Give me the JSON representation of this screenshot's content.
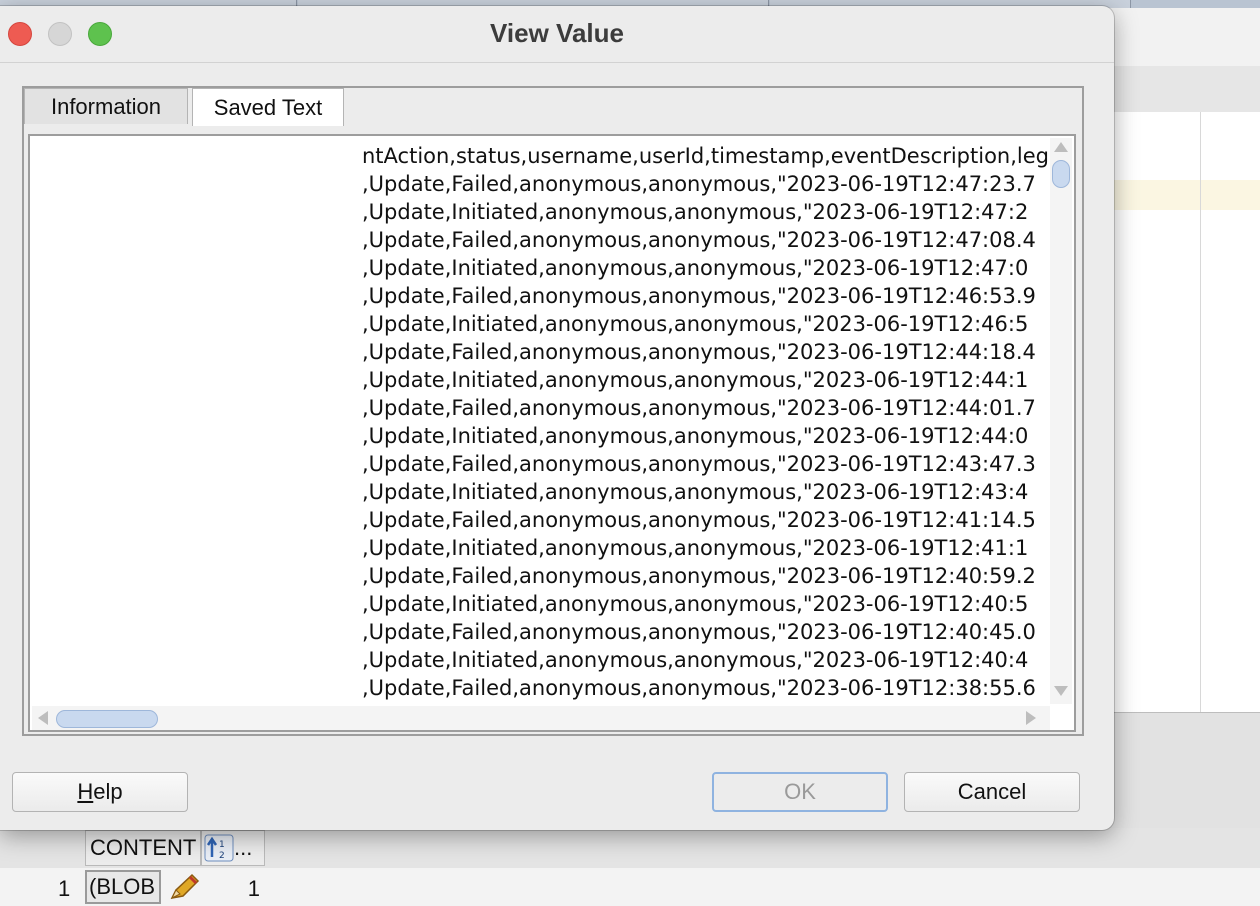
{
  "dialog": {
    "title": "View Value",
    "tabs": [
      {
        "label": "Information",
        "selected": false
      },
      {
        "label": "Saved Text",
        "selected": true
      }
    ],
    "buttons": {
      "help_first": "H",
      "help_rest": "elp",
      "ok": "OK",
      "cancel": "Cancel"
    },
    "text_lines": [
      "ntAction,status,username,userId,timestamp,eventDescription,leg",
      ",Update,Failed,anonymous,anonymous,\"2023-06-19T12:47:23.7",
      ",Update,Initiated,anonymous,anonymous,\"2023-06-19T12:47:2",
      ",Update,Failed,anonymous,anonymous,\"2023-06-19T12:47:08.4",
      ",Update,Initiated,anonymous,anonymous,\"2023-06-19T12:47:0",
      ",Update,Failed,anonymous,anonymous,\"2023-06-19T12:46:53.9",
      ",Update,Initiated,anonymous,anonymous,\"2023-06-19T12:46:5",
      ",Update,Failed,anonymous,anonymous,\"2023-06-19T12:44:18.4",
      ",Update,Initiated,anonymous,anonymous,\"2023-06-19T12:44:1",
      ",Update,Failed,anonymous,anonymous,\"2023-06-19T12:44:01.7",
      ",Update,Initiated,anonymous,anonymous,\"2023-06-19T12:44:0",
      ",Update,Failed,anonymous,anonymous,\"2023-06-19T12:43:47.3",
      ",Update,Initiated,anonymous,anonymous,\"2023-06-19T12:43:4",
      ",Update,Failed,anonymous,anonymous,\"2023-06-19T12:41:14.5",
      ",Update,Initiated,anonymous,anonymous,\"2023-06-19T12:41:1",
      ",Update,Failed,anonymous,anonymous,\"2023-06-19T12:40:59.2",
      ",Update,Initiated,anonymous,anonymous,\"2023-06-19T12:40:5",
      ",Update,Failed,anonymous,anonymous,\"2023-06-19T12:40:45.0",
      ",Update,Initiated,anonymous,anonymous,\"2023-06-19T12:40:4",
      ",Update,Failed,anonymous,anonymous,\"2023-06-19T12:38:55.6"
    ]
  },
  "grid": {
    "columns": [
      "CONTENT",
      "..."
    ],
    "row_number": "1",
    "blob_cell": "(BLOB",
    "value_cell": "1"
  },
  "icons": {
    "window_close": "close-icon",
    "window_minimize": "minimize-icon",
    "window_maximize": "maximize-icon",
    "sort": "sort-icon",
    "edit": "pencil-icon"
  },
  "colors": {
    "close": "#ee5b52",
    "minimize": "#d6d6d6",
    "maximize": "#5ec24e",
    "scroll_thumb": "#c9d9ef",
    "ok_focus_border": "#8fb3e0"
  }
}
